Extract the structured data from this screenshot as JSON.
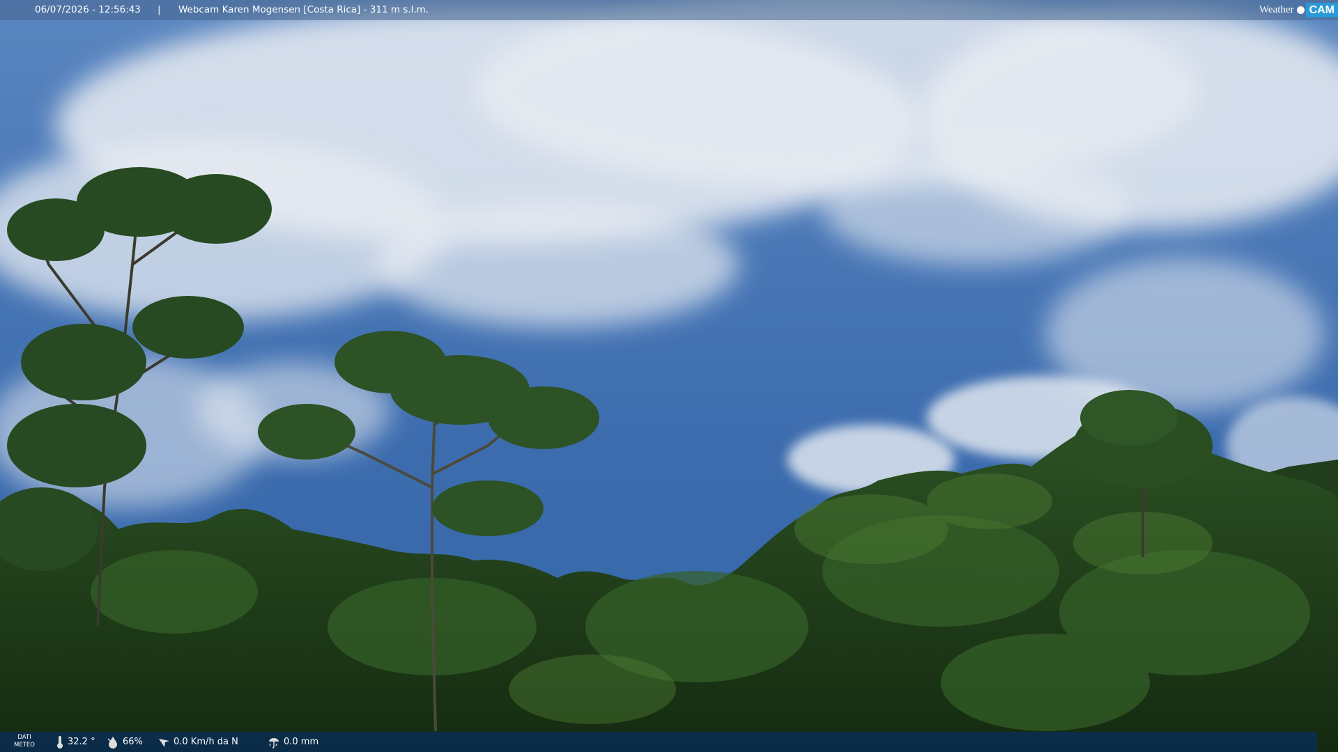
{
  "header": {
    "timestamp": "06/07/2026 - 12:56:43",
    "separator": "|",
    "camera_label": "Webcam Karen Mogensen [Costa Rica] - 311 m s.l.m.",
    "brand_left": "Weather",
    "brand_right": "CAM"
  },
  "footer": {
    "dati_line1": "DATI",
    "dati_line2": "METEO",
    "temperature": "32.2 °",
    "humidity": "66%",
    "wind": "0.0 Km/h da N",
    "rain": "0.0 mm"
  },
  "icons": {
    "temperature": "thermometer-icon",
    "humidity": "humidity-drop-icon",
    "wind": "wind-icon",
    "rain": "rain-gauge-icon"
  },
  "colors": {
    "sky": "#3a6aa8",
    "brand_blue": "#2a9ad6",
    "foliage": "#1f3d1a"
  }
}
